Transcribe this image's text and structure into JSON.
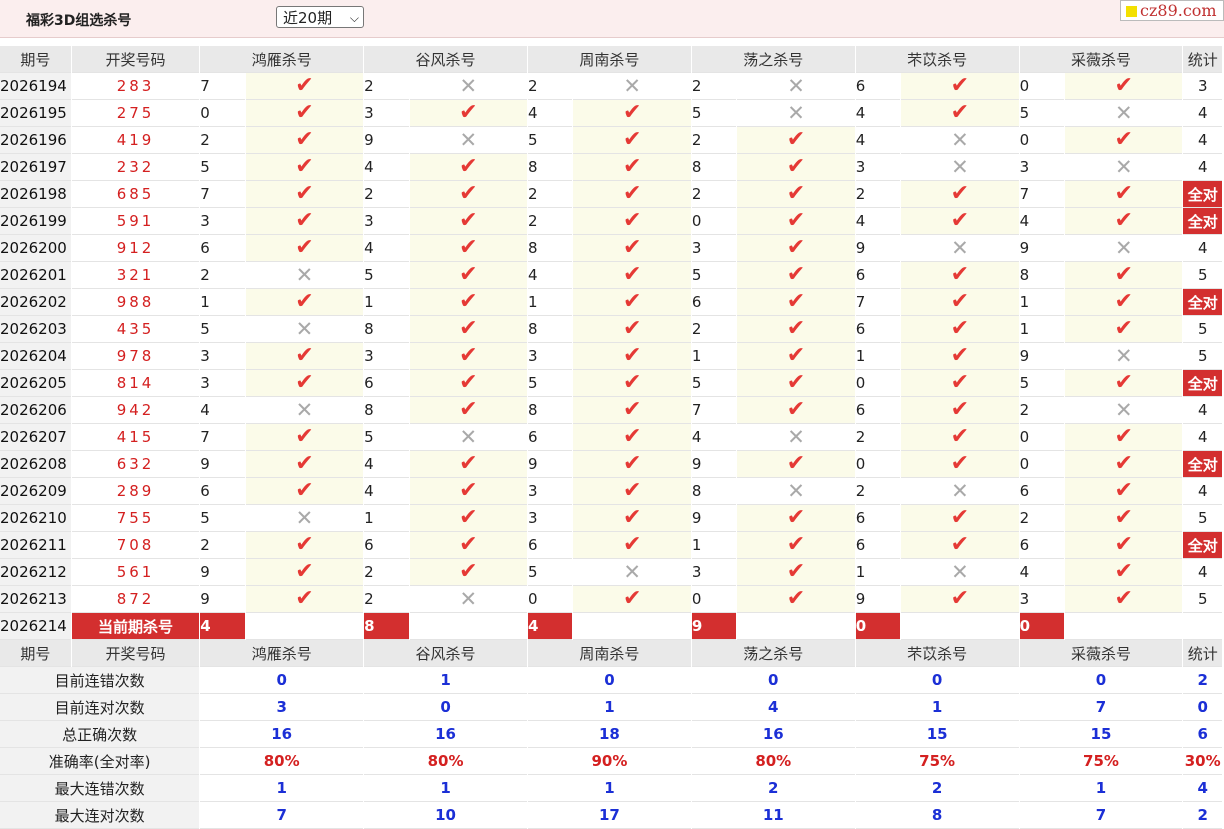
{
  "header": {
    "title": "福彩3D组选杀号",
    "period_select": "近20期",
    "brand": "cz89.com"
  },
  "columns": {
    "issue": "期号",
    "draw": "开奖号码",
    "experts": [
      "鸿雁杀号",
      "谷风杀号",
      "周南杀号",
      "荡之杀号",
      "芣苡杀号",
      "采薇杀号"
    ],
    "tally": "统计"
  },
  "rows": [
    {
      "issue": "2026194",
      "draw": "283",
      "kills": [
        7,
        2,
        2,
        2,
        6,
        0
      ],
      "ok": [
        1,
        0,
        0,
        0,
        1,
        1
      ],
      "tally": "3"
    },
    {
      "issue": "2026195",
      "draw": "275",
      "kills": [
        0,
        3,
        4,
        5,
        4,
        5
      ],
      "ok": [
        1,
        1,
        1,
        0,
        1,
        0
      ],
      "tally": "4"
    },
    {
      "issue": "2026196",
      "draw": "419",
      "kills": [
        2,
        9,
        5,
        2,
        4,
        0
      ],
      "ok": [
        1,
        0,
        1,
        1,
        0,
        1
      ],
      "tally": "4"
    },
    {
      "issue": "2026197",
      "draw": "232",
      "kills": [
        5,
        4,
        8,
        8,
        3,
        3
      ],
      "ok": [
        1,
        1,
        1,
        1,
        0,
        0
      ],
      "tally": "4"
    },
    {
      "issue": "2026198",
      "draw": "685",
      "kills": [
        7,
        2,
        2,
        2,
        2,
        7
      ],
      "ok": [
        1,
        1,
        1,
        1,
        1,
        1
      ],
      "tally": "全对"
    },
    {
      "issue": "2026199",
      "draw": "591",
      "kills": [
        3,
        3,
        2,
        0,
        4,
        4
      ],
      "ok": [
        1,
        1,
        1,
        1,
        1,
        1
      ],
      "tally": "全对"
    },
    {
      "issue": "2026200",
      "draw": "912",
      "kills": [
        6,
        4,
        8,
        3,
        9,
        9
      ],
      "ok": [
        1,
        1,
        1,
        1,
        0,
        0
      ],
      "tally": "4"
    },
    {
      "issue": "2026201",
      "draw": "321",
      "kills": [
        2,
        5,
        4,
        5,
        6,
        8
      ],
      "ok": [
        0,
        1,
        1,
        1,
        1,
        1
      ],
      "tally": "5"
    },
    {
      "issue": "2026202",
      "draw": "988",
      "kills": [
        1,
        1,
        1,
        6,
        7,
        1
      ],
      "ok": [
        1,
        1,
        1,
        1,
        1,
        1
      ],
      "tally": "全对"
    },
    {
      "issue": "2026203",
      "draw": "435",
      "kills": [
        5,
        8,
        8,
        2,
        6,
        1
      ],
      "ok": [
        0,
        1,
        1,
        1,
        1,
        1
      ],
      "tally": "5"
    },
    {
      "issue": "2026204",
      "draw": "978",
      "kills": [
        3,
        3,
        3,
        1,
        1,
        9
      ],
      "ok": [
        1,
        1,
        1,
        1,
        1,
        0
      ],
      "tally": "5"
    },
    {
      "issue": "2026205",
      "draw": "814",
      "kills": [
        3,
        6,
        5,
        5,
        0,
        5
      ],
      "ok": [
        1,
        1,
        1,
        1,
        1,
        1
      ],
      "tally": "全对"
    },
    {
      "issue": "2026206",
      "draw": "942",
      "kills": [
        4,
        8,
        8,
        7,
        6,
        2
      ],
      "ok": [
        0,
        1,
        1,
        1,
        1,
        0
      ],
      "tally": "4"
    },
    {
      "issue": "2026207",
      "draw": "415",
      "kills": [
        7,
        5,
        6,
        4,
        2,
        0
      ],
      "ok": [
        1,
        0,
        1,
        0,
        1,
        1
      ],
      "tally": "4"
    },
    {
      "issue": "2026208",
      "draw": "632",
      "kills": [
        9,
        4,
        9,
        9,
        0,
        0
      ],
      "ok": [
        1,
        1,
        1,
        1,
        1,
        1
      ],
      "tally": "全对"
    },
    {
      "issue": "2026209",
      "draw": "289",
      "kills": [
        6,
        4,
        3,
        8,
        2,
        6
      ],
      "ok": [
        1,
        1,
        1,
        0,
        0,
        1
      ],
      "tally": "4"
    },
    {
      "issue": "2026210",
      "draw": "755",
      "kills": [
        5,
        1,
        3,
        9,
        6,
        2
      ],
      "ok": [
        0,
        1,
        1,
        1,
        1,
        1
      ],
      "tally": "5"
    },
    {
      "issue": "2026211",
      "draw": "708",
      "kills": [
        2,
        6,
        6,
        1,
        6,
        6
      ],
      "ok": [
        1,
        1,
        1,
        1,
        1,
        1
      ],
      "tally": "全对"
    },
    {
      "issue": "2026212",
      "draw": "561",
      "kills": [
        9,
        2,
        5,
        3,
        1,
        4
      ],
      "ok": [
        1,
        1,
        0,
        1,
        0,
        1
      ],
      "tally": "4"
    },
    {
      "issue": "2026213",
      "draw": "872",
      "kills": [
        9,
        2,
        0,
        0,
        9,
        3
      ],
      "ok": [
        1,
        0,
        1,
        1,
        1,
        1
      ],
      "tally": "5"
    }
  ],
  "current": {
    "issue": "2026214",
    "label": "当前期杀号",
    "kills": [
      "4",
      "8",
      "4",
      "9",
      "0",
      "0"
    ]
  },
  "stats": [
    {
      "label": "目前连错次数",
      "values": [
        "0",
        "1",
        "0",
        "0",
        "0",
        "0"
      ],
      "tally": "2",
      "rate": false
    },
    {
      "label": "目前连对次数",
      "values": [
        "3",
        "0",
        "1",
        "4",
        "1",
        "7"
      ],
      "tally": "0",
      "rate": false
    },
    {
      "label": "总正确次数",
      "values": [
        "16",
        "16",
        "18",
        "16",
        "15",
        "15"
      ],
      "tally": "6",
      "rate": false
    },
    {
      "label": "准确率(全对率)",
      "values": [
        "80%",
        "80%",
        "90%",
        "80%",
        "75%",
        "75%"
      ],
      "tally": "30%",
      "rate": true
    },
    {
      "label": "最大连错次数",
      "values": [
        "1",
        "1",
        "1",
        "2",
        "2",
        "1"
      ],
      "tally": "4",
      "rate": false
    },
    {
      "label": "最大连对次数",
      "values": [
        "7",
        "10",
        "17",
        "11",
        "8",
        "7"
      ],
      "tally": "2",
      "rate": false
    }
  ],
  "icons": {
    "correct": "check-icon",
    "wrong": "cross-icon"
  },
  "colors": {
    "accent_red": "#d32f2f",
    "check_red": "#e53935",
    "stat_blue": "#1b2fd6",
    "ok_cell_bg": "#fbfbe9"
  }
}
